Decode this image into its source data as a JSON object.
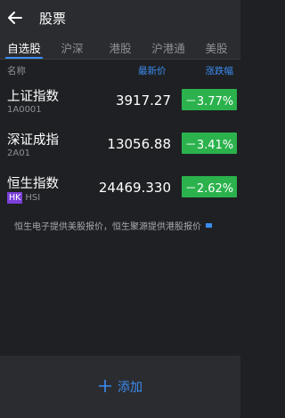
{
  "header": {
    "title": "股票"
  },
  "tabs": [
    {
      "label": "自选股",
      "active": true
    },
    {
      "label": "沪深",
      "active": false
    },
    {
      "label": "港股",
      "active": false
    },
    {
      "label": "沪港通",
      "active": false
    },
    {
      "label": "美股",
      "active": false
    }
  ],
  "columns": {
    "name": "名称",
    "price": "最新价",
    "change": "涨跌幅"
  },
  "stocks": [
    {
      "name": "上证指数",
      "code": "1A0001",
      "badge": "",
      "price": "3917.27",
      "change": "－3.77%"
    },
    {
      "name": "深证成指",
      "code": "2A01",
      "badge": "",
      "price": "13056.88",
      "change": "－3.41%"
    },
    {
      "name": "恒生指数",
      "code": "HSI",
      "badge": "HK",
      "price": "24469.330",
      "change": "－2.62%"
    }
  ],
  "note": "恒生电子提供美股报价，恒生聚源提供港股报价",
  "footer": {
    "add_label": "添加",
    "add_icon": "plus-icon"
  },
  "colors": {
    "background": "#1f2023",
    "bar": "#2b2c30",
    "accent": "#3b8cf0",
    "change_badge": "#2bb24c",
    "hk_badge": "#7b3fd8"
  }
}
